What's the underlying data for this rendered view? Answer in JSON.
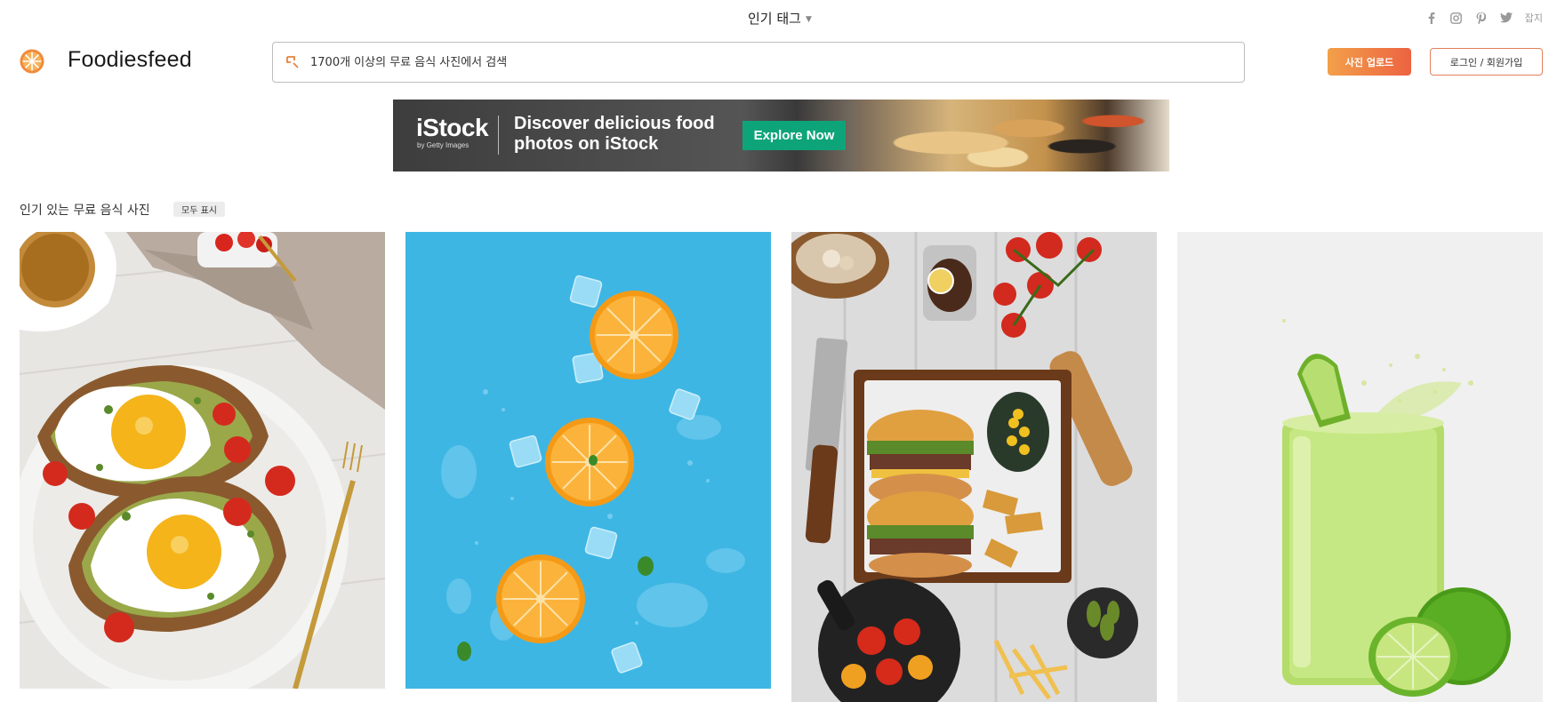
{
  "topbar": {
    "tags_label": "인기 태그",
    "tags_icon": "chevron-down-icon",
    "social_icons": [
      "facebook-icon",
      "instagram-icon",
      "pinterest-icon",
      "twitter-icon"
    ],
    "magazine_label": "잡지"
  },
  "header": {
    "logo_text": "Foodiesfeed",
    "logo_icon": "orange-slice-logo-icon",
    "search_placeholder": "1700개 이상의 무료 음식 사진에서 검색",
    "search_icon": "search-icon",
    "upload_label": "사진 업로드",
    "login_label": "로그인 / 회원가입"
  },
  "ad": {
    "brand": "iStock",
    "brand_sub": "by Getty Images",
    "tagline": "Discover delicious food photos on iStock",
    "cta": "Explore Now",
    "colors": {
      "cta": "#0ea47a",
      "background": "#3d3d3d"
    }
  },
  "section": {
    "title": "인기 있는 무료 음식 사진",
    "show_all": "모두 표시"
  },
  "photos": [
    {
      "subject": "avocado toast with fried eggs and cherry tomatoes"
    },
    {
      "subject": "orange slices and ice cubes on blue background"
    },
    {
      "subject": "burgers, fries and vegetables on wooden tray"
    },
    {
      "subject": "green lime juice in glass with splash"
    }
  ],
  "colors": {
    "accent_orange": "#f3a04a",
    "accent_red": "#ec6341",
    "text": "#222222"
  }
}
